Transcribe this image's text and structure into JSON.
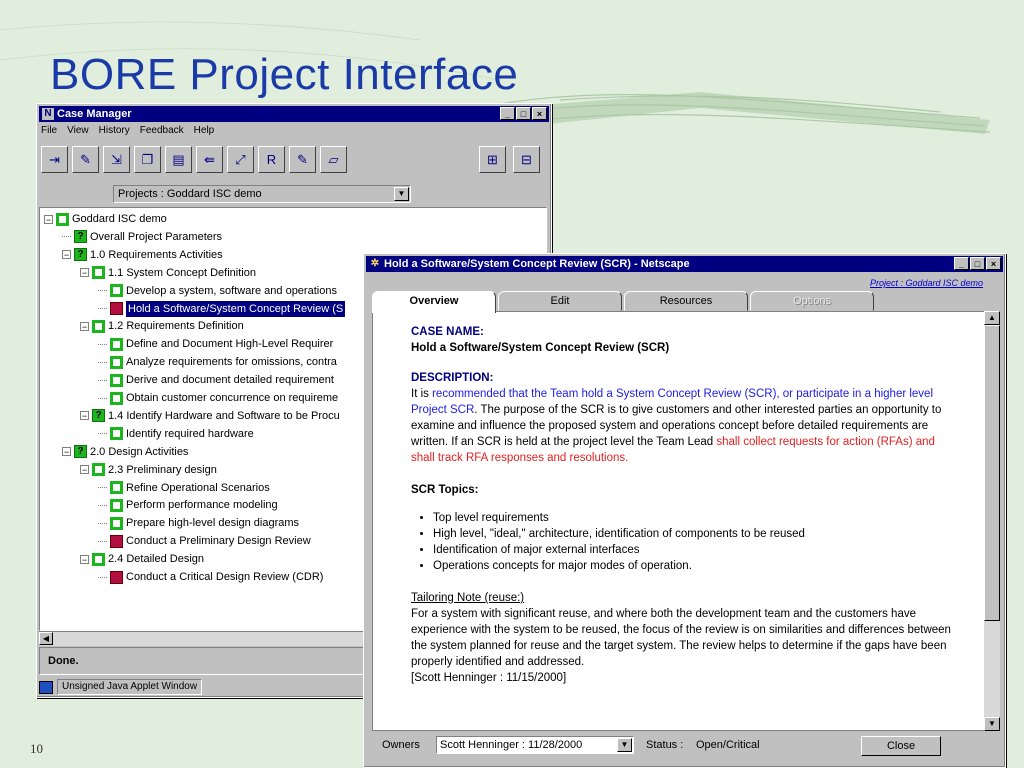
{
  "slide": {
    "title": "BORE Project Interface",
    "page_number": "10"
  },
  "case_manager": {
    "title": "Case Manager",
    "title_icon": "N",
    "menu": [
      "File",
      "View",
      "History",
      "Feedback",
      "Help"
    ],
    "project_select": "Projects : Goddard ISC demo",
    "tree": [
      {
        "label": "Goddard ISC demo",
        "icon": "green",
        "expander": "−"
      },
      {
        "label": "Overall Project Parameters",
        "icon": "q"
      },
      {
        "label": "1.0 Requirements Activities",
        "icon": "q",
        "expander": "−"
      },
      {
        "label": "1.1 System Concept Definition",
        "icon": "green",
        "expander": "−"
      },
      {
        "label": "Develop a system, software and operations",
        "icon": "green"
      },
      {
        "label": "Hold a Software/System Concept Review (S",
        "icon": "red",
        "selected": true
      },
      {
        "label": "1.2 Requirements Definition",
        "icon": "green",
        "expander": "−"
      },
      {
        "label": "Define and Document High-Level Requirer",
        "icon": "green"
      },
      {
        "label": "Analyze requirements for omissions, contra",
        "icon": "green"
      },
      {
        "label": "Derive and document detailed requirement",
        "icon": "green"
      },
      {
        "label": "Obtain customer concurrence on requireme",
        "icon": "green"
      },
      {
        "label": "1.4 Identify Hardware and Software to be Procu",
        "icon": "q",
        "expander": "−"
      },
      {
        "label": "Identify required hardware",
        "icon": "green"
      },
      {
        "label": "2.0 Design Activities",
        "icon": "q",
        "expander": "−"
      },
      {
        "label": "2.3 Preliminary design",
        "icon": "green",
        "expander": "−"
      },
      {
        "label": "Refine Operational Scenarios",
        "icon": "green"
      },
      {
        "label": "Perform performance modeling",
        "icon": "green"
      },
      {
        "label": "Prepare high-level design diagrams",
        "icon": "green"
      },
      {
        "label": "Conduct a Preliminary Design Review",
        "icon": "red"
      },
      {
        "label": "2.4 Detailed Design",
        "icon": "green",
        "expander": "−"
      },
      {
        "label": "Conduct a Critical Design Review (CDR)",
        "icon": "red"
      }
    ],
    "status_text": "Done.",
    "applet_text": "Unsigned Java Applet Window"
  },
  "netscape": {
    "title": "Hold a Software/System Concept Review (SCR) - Netscape",
    "project_link": "Project : Goddard ISC demo",
    "tabs": [
      {
        "label": "Overview",
        "state": "active"
      },
      {
        "label": "Edit",
        "state": "normal"
      },
      {
        "label": "Resources",
        "state": "normal"
      },
      {
        "label": "Options",
        "state": "disabled"
      }
    ],
    "case_name_heading": "CASE NAME:",
    "case_name": "Hold a Software/System Concept Review (SCR)",
    "description_heading": "DESCRIPTION:",
    "desc_part1": "It is ",
    "desc_blue": "recommended that the Team hold a System Concept Review (SCR), or participate in a higher level Project SCR",
    "desc_part2": ". The purpose of the SCR is to give customers and other interested parties an opportunity to examine and influence the proposed system and operations concept before detailed requirements are written. If an SCR is held at the project level the Team Lead ",
    "desc_red": "shall collect requests for action (RFAs) and shall track RFA responses and resolutions.",
    "topics_heading": "SCR Topics:",
    "topics": [
      "Top level requirements",
      "High level, \"ideal,\" architecture, identification of components to be reused",
      "Identification of major external interfaces",
      "Operations concepts for major modes of operation."
    ],
    "tailoring_heading": "Tailoring Note (reuse:)",
    "tailoring_text": "For a system with significant reuse, and where both the development team and the customers have experience with the system to be reused, the focus of the review is on similarities and differences between the system planned for reuse and the target system. The review helps to determine if the gaps have been properly identified and addressed.",
    "tailoring_sig": "[Scott Henninger : 11/15/2000]",
    "owners_label": "Owners",
    "owners_value": "Scott Henninger : 11/28/2000",
    "status_label": "Status :",
    "status_value": "Open/Critical",
    "close_label": "Close"
  }
}
